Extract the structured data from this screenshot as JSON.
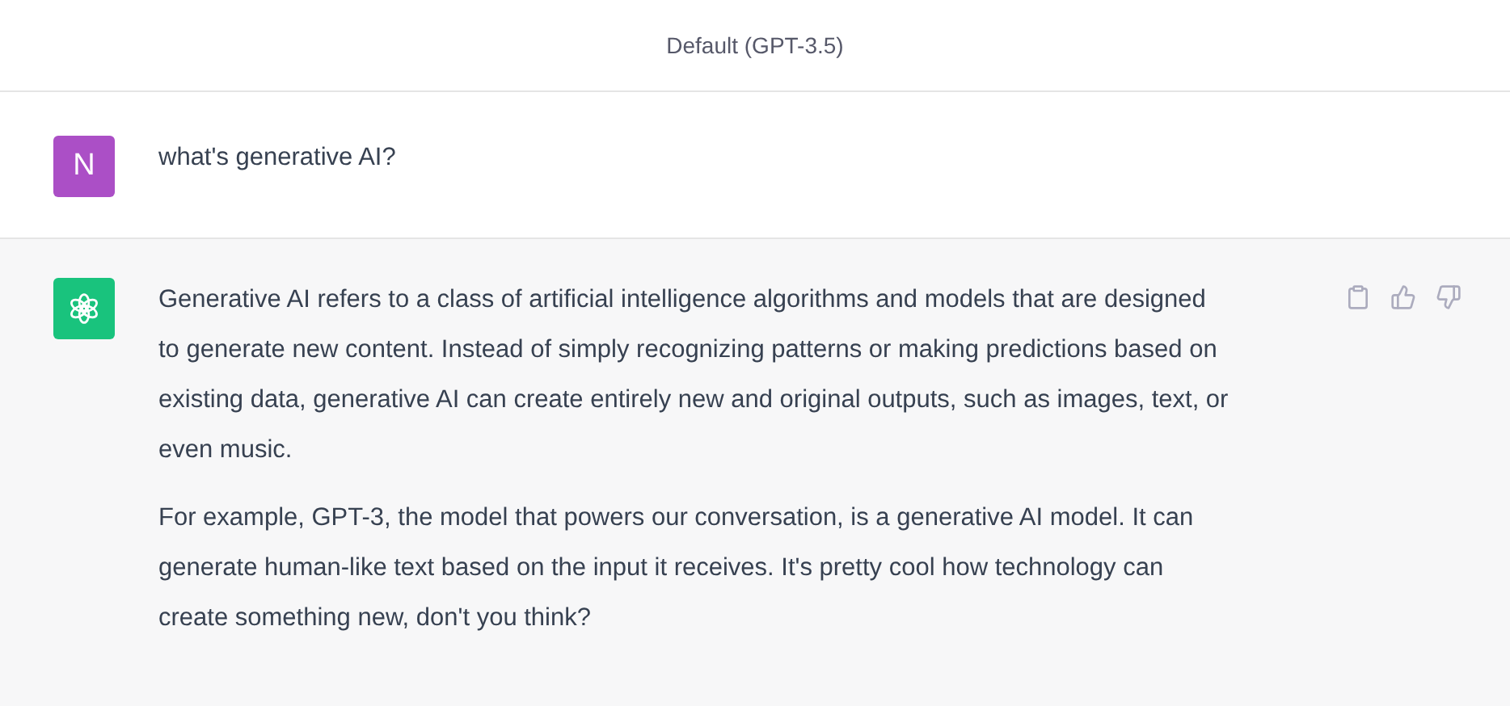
{
  "header": {
    "title": "Default (GPT-3.5)"
  },
  "messages": [
    {
      "kind": "user",
      "avatar_letter": "N",
      "paragraphs": [
        "what's generative AI?"
      ]
    },
    {
      "kind": "assistant",
      "paragraphs": [
        "Generative AI refers to a class of artificial intelligence algorithms and models that are designed to generate new content. Instead of simply recognizing patterns or making predictions based on existing data, generative AI can create entirely new and original outputs, such as images, text, or even music.",
        "For example, GPT-3, the model that powers our conversation, is a generative AI model. It can generate human-like text based on the input it receives. It's pretty cool how technology can create something new, don't you think?"
      ]
    }
  ]
}
